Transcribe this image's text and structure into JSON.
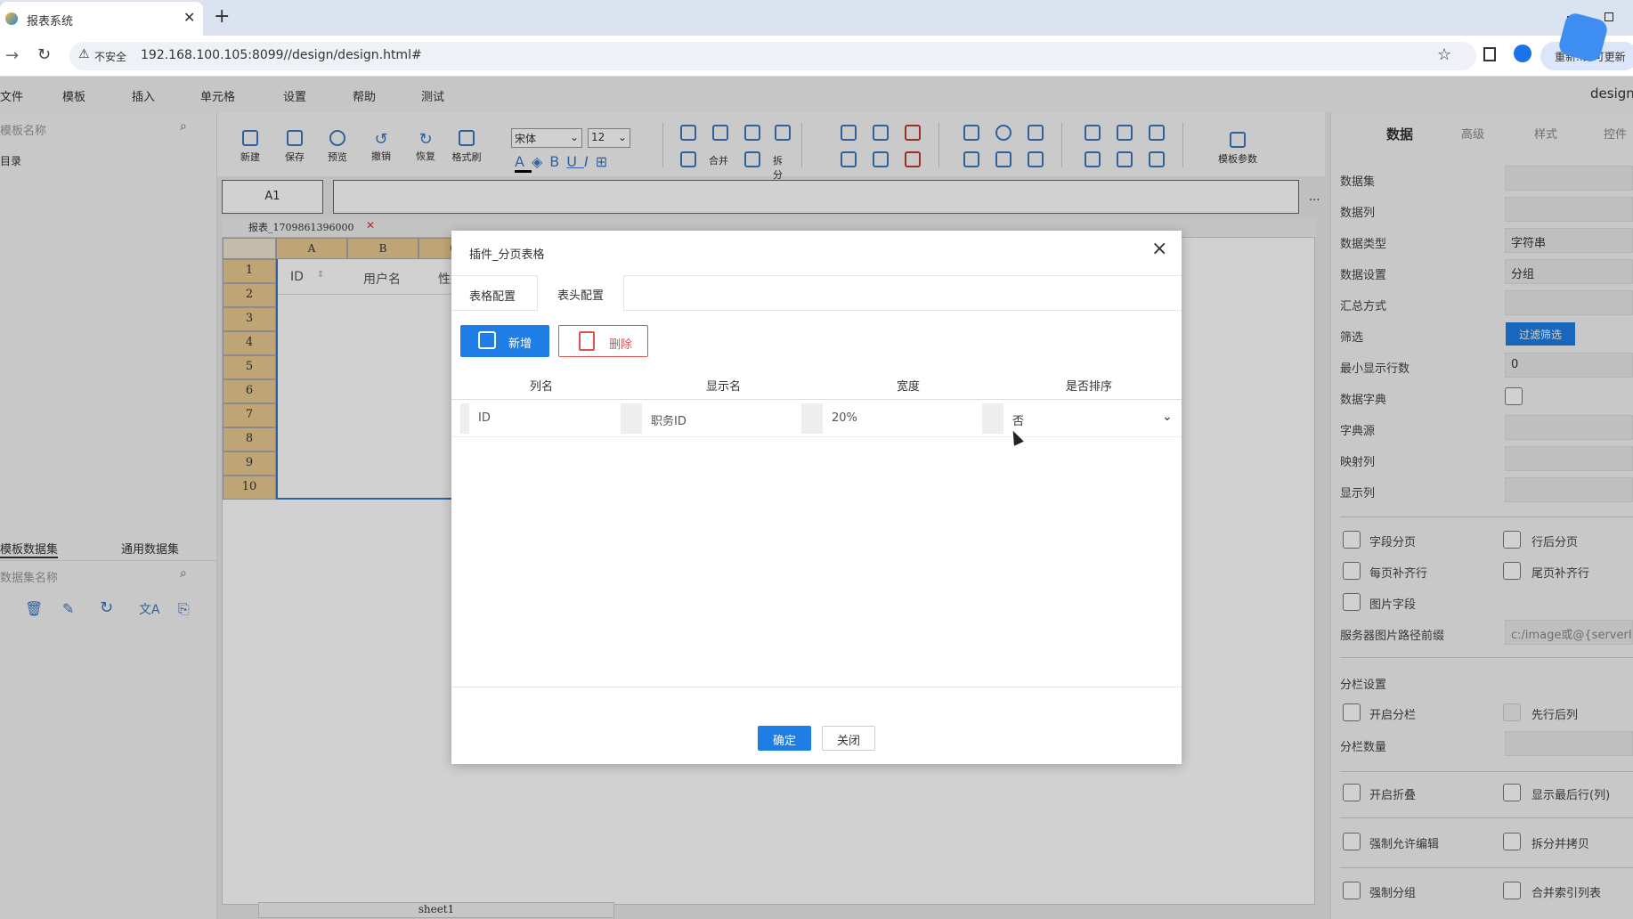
{
  "browser": {
    "tab_title": "报表系统",
    "new_tab": "+",
    "insecure": "不安全",
    "url": "192.168.100.105:8099//design/design.html#",
    "profile_text": "重新..即可更新"
  },
  "menu": [
    "文件",
    "模板",
    "插入",
    "单元格",
    "设置",
    "帮助",
    "测试"
  ],
  "menu_right": "design",
  "left": {
    "search_placeholder": "模板名称",
    "tree_root": "目录",
    "dataset_tabs": [
      "模板数据集",
      "通用数据集"
    ],
    "dataset_search": "数据集名称"
  },
  "toolbar": {
    "new": "新建",
    "save": "保存",
    "preview": "预览",
    "undo": "撤销",
    "redo": "恢复",
    "format": "格式刷",
    "font": "宋体",
    "size": "12",
    "merge": "合并",
    "split": "拆分",
    "template_params": "模板参数"
  },
  "formula": {
    "cell": "A1",
    "value": "",
    "more": "..."
  },
  "sheet": {
    "file_tab": "报表_1709861396000",
    "cols": [
      "A",
      "B",
      "C"
    ],
    "rows": [
      "1",
      "2",
      "3",
      "4",
      "5",
      "6",
      "7",
      "8",
      "9",
      "10"
    ],
    "headers": [
      "ID",
      "用户名",
      "性别"
    ],
    "bottom_tab": "sheet1"
  },
  "right": {
    "tabs": [
      "数据",
      "高级",
      "样式",
      "控件"
    ],
    "fields": [
      {
        "label": "数据集",
        "value": ""
      },
      {
        "label": "数据列",
        "value": ""
      },
      {
        "label": "数据类型",
        "value": "字符串"
      },
      {
        "label": "数据设置",
        "value": "分组"
      },
      {
        "label": "汇总方式",
        "value": ""
      },
      {
        "label": "筛选",
        "value": "过滤筛选"
      },
      {
        "label": "最小显示行数",
        "value": "0"
      },
      {
        "label": "数据字典",
        "value": ""
      },
      {
        "label": "字典源",
        "value": ""
      },
      {
        "label": "映射列",
        "value": ""
      },
      {
        "label": "显示列",
        "value": ""
      }
    ],
    "checks_a": [
      "字段分页",
      "行后分页",
      "每页补齐行",
      "尾页补齐行",
      "图片字段"
    ],
    "server_path_label": "服务器图片路径前缀",
    "server_path_value": "c:/image或@{serverIma",
    "column_section": "分栏设置",
    "open_columns": "开启分栏",
    "row_first": "先行后列",
    "column_count": "分栏数量",
    "checks_b": [
      "开启折叠",
      "显示最后行(列)",
      "强制允许编辑",
      "拆分并拷贝",
      "强制分组",
      "合并索引列表"
    ]
  },
  "dialog": {
    "title": "插件_分页表格",
    "close": "×",
    "tabs": [
      "表格配置",
      "表头配置"
    ],
    "add": "新增",
    "delete": "删除",
    "columns": [
      "列名",
      "显示名",
      "宽度",
      "是否排序"
    ],
    "row": {
      "name": "ID",
      "display": "职务ID",
      "width": "20%",
      "sort": "否"
    },
    "ok": "确定",
    "cancel": "关闭"
  }
}
